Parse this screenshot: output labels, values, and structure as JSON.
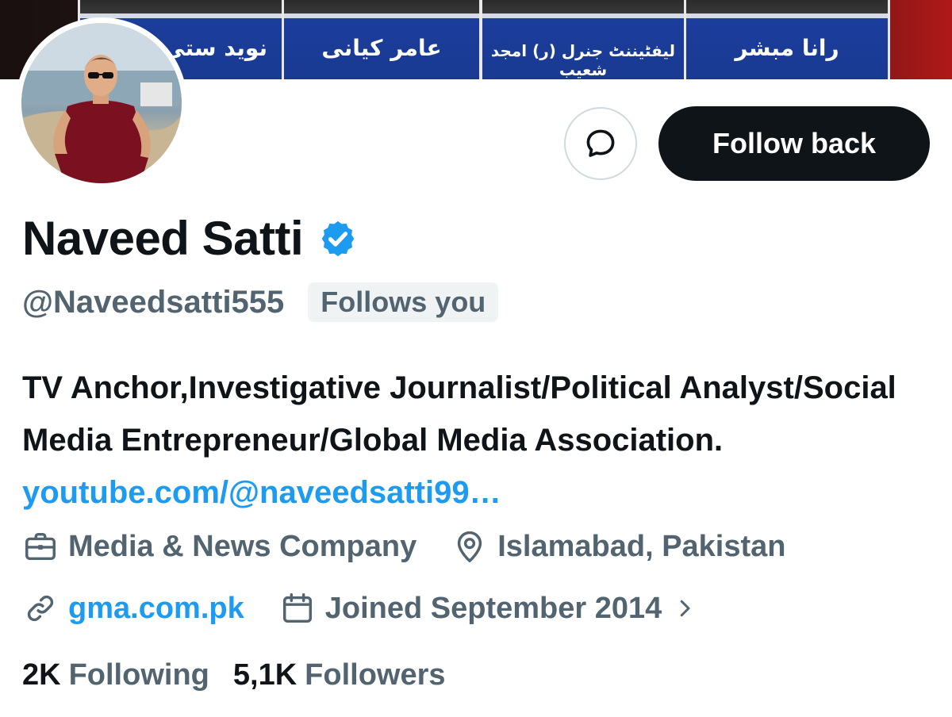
{
  "banner": {
    "captions": [
      "نوید ستی",
      "عامر کیانی",
      "لیفٹیننٹ جنرل (ر) امجد شعیب",
      "رانا مبشر"
    ]
  },
  "profile": {
    "name": "Naveed Satti",
    "handle": "@Naveedsatti555",
    "follows_you": "Follows you",
    "bio_text": "TV Anchor,Investigative Journalist/Political Analyst/Social Media Entrepreneur/Global Media Association.",
    "bio_link": "youtube.com/@naveedsatti99…",
    "category": "Media & News Company",
    "location": "Islamabad, Pakistan",
    "website": "gma.com.pk",
    "joined": "Joined September 2014"
  },
  "actions": {
    "follow_back_label": "Follow back"
  },
  "stats": {
    "following_count": "2K",
    "following_label": "Following",
    "followers_count": "5,1K",
    "followers_label": "Followers"
  },
  "icons": {
    "message": "message-bubble-icon",
    "verified": "verified-badge-icon",
    "category": "briefcase-icon",
    "location": "location-pin-icon",
    "website": "link-icon",
    "joined": "calendar-icon",
    "joined_more": "chevron-right-icon"
  },
  "colors": {
    "primary_text": "#0f1419",
    "secondary_text": "#536471",
    "accent": "#1d9bf0",
    "button_dark": "#0f1419",
    "badge_bg": "#eff3f4"
  }
}
